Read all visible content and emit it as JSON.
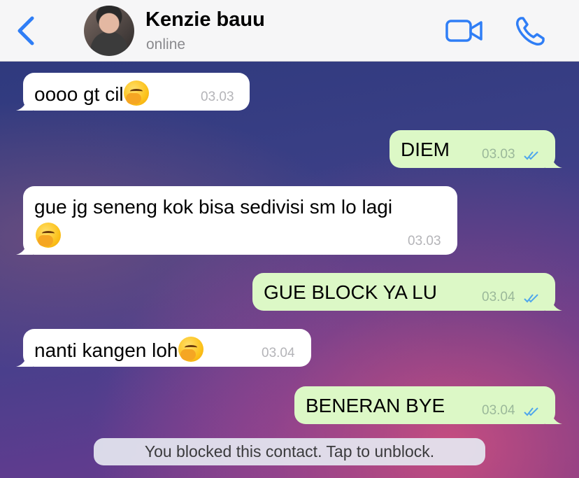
{
  "header": {
    "contact_name": "Kenzie bauu",
    "status": "online",
    "icons": [
      "chevron-left-icon",
      "video-camera-icon",
      "phone-icon"
    ],
    "accent_color": "#2f7ef6"
  },
  "messages": [
    {
      "direction": "incoming",
      "text": "oooo gt cil",
      "emoji": "face-with-hand-over-mouth",
      "time": "03.03"
    },
    {
      "direction": "outgoing",
      "text": "DIEM",
      "time": "03.03",
      "read": true
    },
    {
      "direction": "incoming",
      "text": "gue jg seneng kok bisa sedivisi sm lo lagi",
      "emoji": "face-with-hand-over-mouth",
      "time": "03.03"
    },
    {
      "direction": "outgoing",
      "text": "GUE BLOCK YA LU",
      "time": "03.04",
      "read": true
    },
    {
      "direction": "incoming",
      "text": "nanti kangen loh",
      "emoji": "face-with-hand-over-mouth",
      "time": "03.04"
    },
    {
      "direction": "outgoing",
      "text": "BENERAN BYE",
      "time": "03.04",
      "read": true
    }
  ],
  "system_note": "You blocked this contact. Tap to unblock.",
  "colors": {
    "incoming_bubble": "#ffffff",
    "outgoing_bubble": "#dcf8c6",
    "read_ticks": "#4fa6ec"
  }
}
